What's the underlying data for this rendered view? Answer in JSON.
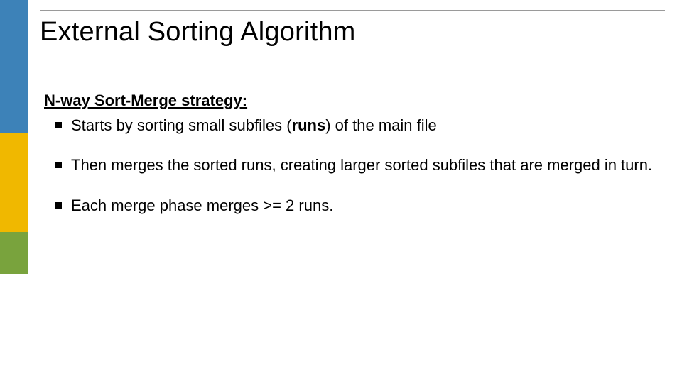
{
  "title": "External Sorting Algorithm",
  "heading_text": "N-way Sort-Merge strategy",
  "heading_colon": ":",
  "bullets": [
    {
      "pre": "Starts by sorting small subfiles (",
      "bold": "runs",
      "post": ") of the main file"
    },
    {
      "pre": "Then merges the sorted runs, creating larger sorted subfiles that are merged in turn.",
      "bold": "",
      "post": ""
    },
    {
      "pre": "Each merge phase merges >= 2 runs.",
      "bold": "",
      "post": ""
    }
  ],
  "colors": {
    "blue": "#3d82b8",
    "orange": "#f0b800",
    "green": "#79a33d"
  }
}
